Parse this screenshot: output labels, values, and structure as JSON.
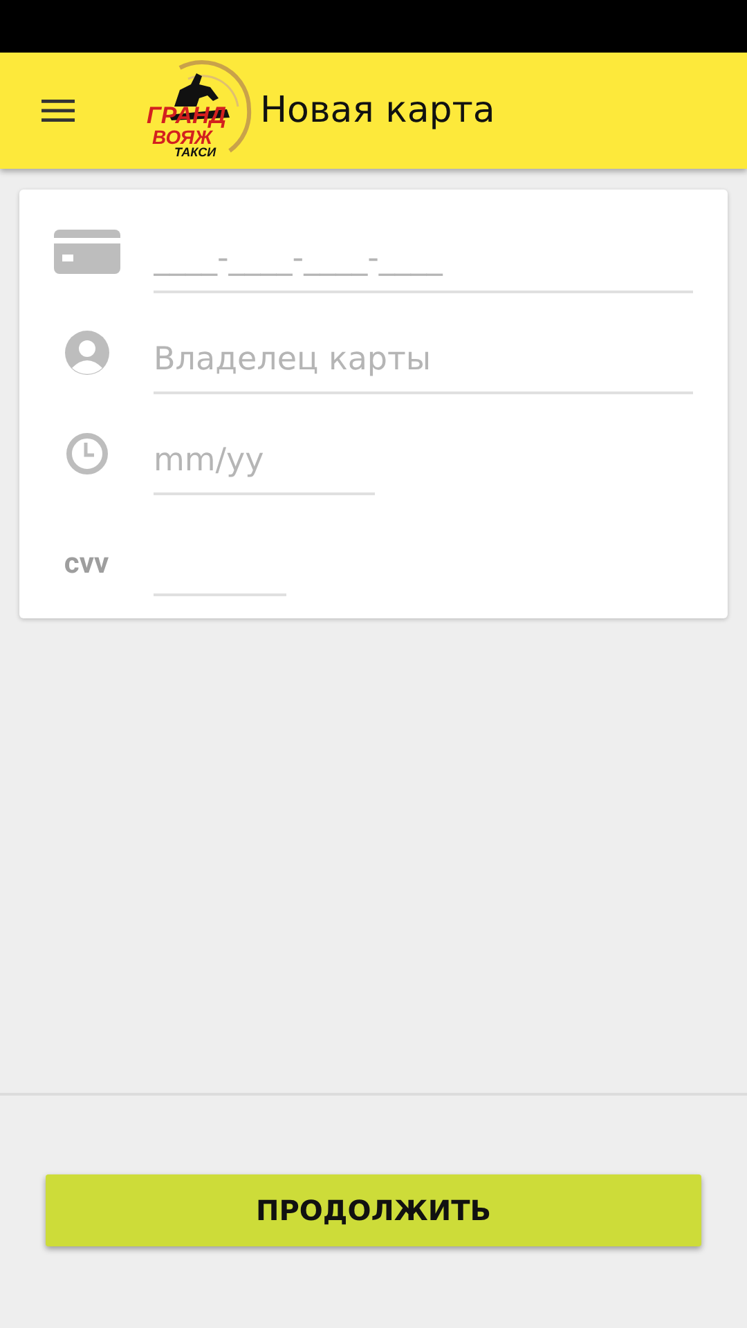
{
  "toolbar": {
    "title": "Новая карта",
    "logo": {
      "line_1": "ГРАНД",
      "line_2": "ВОЯЖ",
      "line_3": "ТАКСИ"
    }
  },
  "fields": [
    {
      "kind": "card",
      "placeholder": "____-____-____-____"
    },
    {
      "kind": "person",
      "placeholder": "Владелец карты"
    },
    {
      "kind": "date",
      "placeholder": "mm/yy"
    },
    {
      "kind": "cvv",
      "label": "cvv"
    }
  ],
  "continue_button": "ПРОДОЛЖИТЬ"
}
